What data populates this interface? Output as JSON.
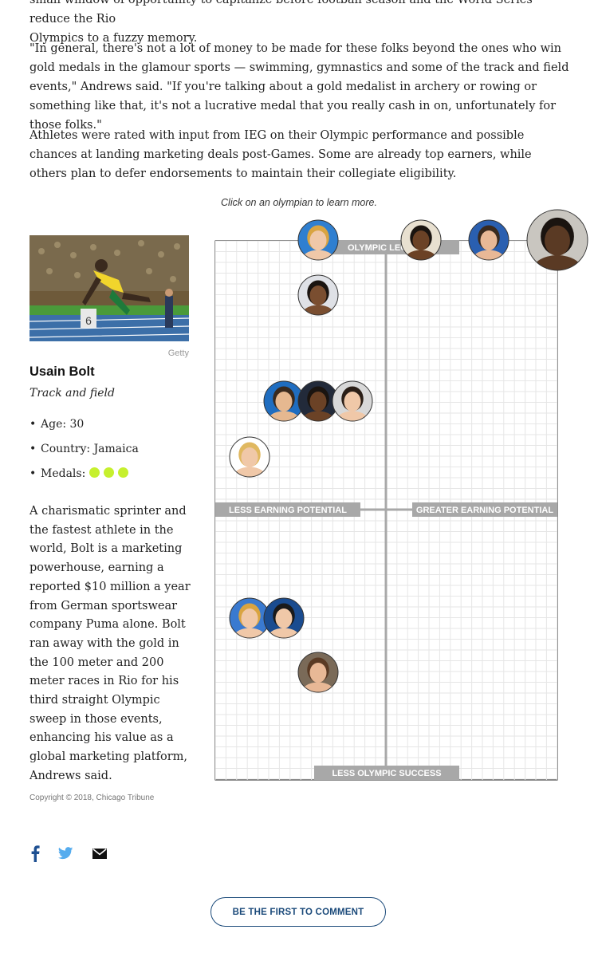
{
  "article": {
    "para_top_line": "small window of opportunity to capitalize before football season and the World Series reduce the Rio",
    "para_top_last": "Olympics to a fuzzy memory.",
    "para_quote": "\"In general, there's not a lot of money to be made for these folks beyond the ones who win gold medals in the glamour sports — swimming, gymnastics and some of the track and field events,\" Andrews said. \"If you're talking about a gold medalist in archery or rowing or something like that, it's not a lucrative medal that you really cash in on, unfortunately for those folks.\"",
    "para_rating": "Athletes were rated with input from IEG on their Olympic performance and possible chances at landing marketing deals post-Games. Some are already top earners, while others plan to defer endorsements to maintain their collegiate eligibility."
  },
  "graphic": {
    "caption": "Click on an olympian to learn more.",
    "axes": {
      "top": "OLYMPIC LEGEND",
      "bottom": "LESS OLYMPIC SUCCESS",
      "left": "LESS EARNING POTENTIAL",
      "right": "GREATER EARNING POTENTIAL"
    },
    "selected": {
      "photo_credit": "Getty",
      "name": "Usain Bolt",
      "sport": "Track and field",
      "age_label": "Age: 30",
      "country_label": "Country: Jamaica",
      "medals_label": "Medals:",
      "gold_medals": 3,
      "medal_color": "#c6f02e",
      "bio": "A charismatic sprinter and the fastest athlete in the world, Bolt is a marketing powerhouse, earning a reported $10 million a year from German sportswear company Puma alone. Bolt ran away with the gold in the 100 meter and 200 meter races in Rio for his third straight Olympic sweep in those events, enhancing his value as a global marketing platform, Andrews said."
    },
    "copyright": "Copyright © 2018, Chicago Tribune",
    "olympian_count": 12
  },
  "social": {
    "facebook_icon": "facebook-icon",
    "twitter_icon": "twitter-icon",
    "email_icon": "email-icon"
  },
  "comments": {
    "button_label": "BE THE FIRST TO COMMENT"
  },
  "colors": {
    "axis_gray": "#a8a8a8",
    "grid": "#e6e6e6",
    "comment_blue": "#1b4a7a",
    "twitter_blue": "#55acee",
    "facebook_blue": "#1d4f91"
  }
}
